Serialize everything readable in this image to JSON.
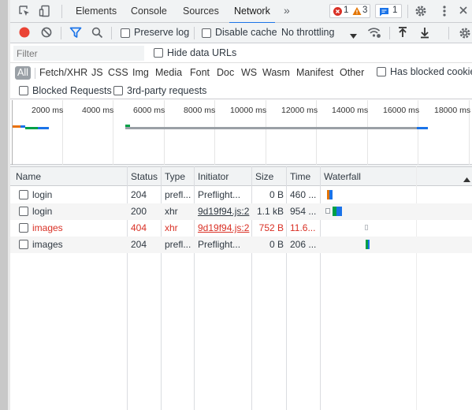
{
  "tabs": [
    "Elements",
    "Console",
    "Sources",
    "Network"
  ],
  "more_tabs_icon": "chevron-double-right-icon",
  "badges": {
    "errors": "1",
    "warnings": "3",
    "messages": "1"
  },
  "toolbar": {
    "preserve_log": "Preserve log",
    "disable_cache": "Disable cache",
    "throttling": "No throttling"
  },
  "filter": {
    "placeholder": "Filter",
    "hide_data_urls": "Hide data URLs"
  },
  "types": [
    "All",
    "Fetch/XHR",
    "JS",
    "CSS",
    "Img",
    "Media",
    "Font",
    "Doc",
    "WS",
    "Wasm",
    "Manifest",
    "Other"
  ],
  "has_blocked_cookies": "Has blocked cookies",
  "blocked_requests": "Blocked Requests",
  "third_party": "3rd-party requests",
  "overview_ticks": [
    "2000 ms",
    "4000 ms",
    "6000 ms",
    "8000 ms",
    "10000 ms",
    "12000 ms",
    "14000 ms",
    "16000 ms",
    "18000 ms"
  ],
  "columns": [
    "Name",
    "Status",
    "Type",
    "Initiator",
    "Size",
    "Time",
    "Waterfall"
  ],
  "rows": [
    {
      "name": "login",
      "status": "204",
      "type": "prefl...",
      "initiator": "Preflight...",
      "size": "0 B",
      "time": "460 ...",
      "error": false
    },
    {
      "name": "login",
      "status": "200",
      "type": "xhr",
      "initiator": "9d19f94.js:2",
      "size": "1.1 kB",
      "time": "954 ...",
      "error": false
    },
    {
      "name": "images",
      "status": "404",
      "type": "xhr",
      "initiator": "9d19f94.js:2",
      "size": "752 B",
      "time": "11.6...",
      "error": true
    },
    {
      "name": "images",
      "status": "204",
      "type": "prefl...",
      "initiator": "Preflight...",
      "size": "0 B",
      "time": "206 ...",
      "error": false
    }
  ],
  "colors": {
    "accent": "#1a73e8",
    "error": "#d93025",
    "record": "#ea4335",
    "waiting": "#00a046",
    "download": "#1a73e8",
    "warning": "#e37400"
  }
}
